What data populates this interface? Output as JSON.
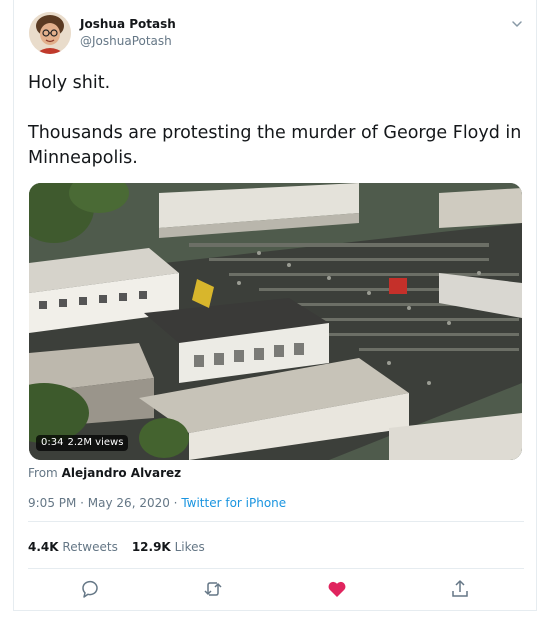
{
  "tweet": {
    "author_name": "Joshua Potash",
    "author_handle": "@JoshuaPotash",
    "text_line1": "Holy shit.",
    "text_line2": "Thousands are protesting the murder of George Floyd in Minneapolis.",
    "media": {
      "duration": "0:34",
      "views": "2.2M views"
    },
    "from_prefix": "From",
    "from_name": "Alejandro Alvarez",
    "timestamp": "9:05 PM · May 26, 2020 · ",
    "source": "Twitter for iPhone",
    "retweets_count": "4.4K",
    "retweets_label": "Retweets",
    "likes_count": "12.9K",
    "likes_label": "Likes"
  },
  "icons": {
    "caret": "chevron-down-icon",
    "reply": "reply-icon",
    "retweet": "retweet-icon",
    "like": "heart-icon",
    "share": "share-icon"
  },
  "colors": {
    "like_active": "#e0245e",
    "link": "#1b95e0",
    "muted": "#657786",
    "icon": "#657786"
  }
}
